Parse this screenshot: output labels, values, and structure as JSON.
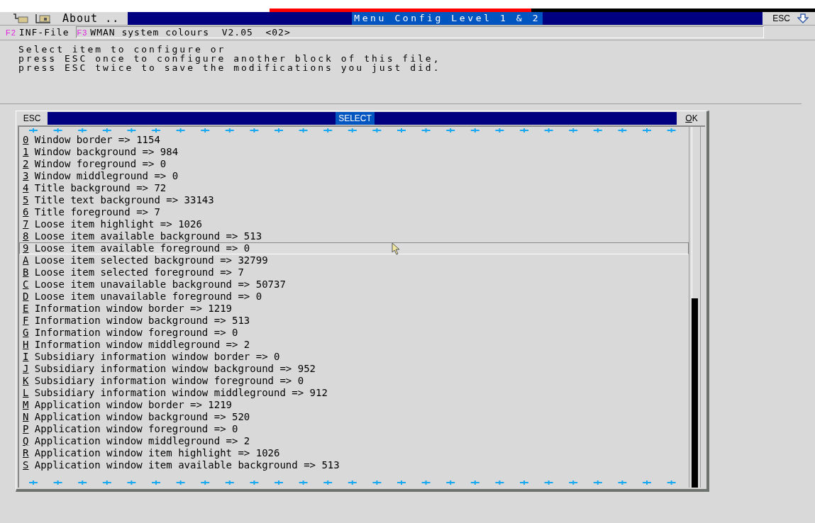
{
  "progress": {
    "level": 0.48
  },
  "menu_bar": {
    "about": "About ..",
    "title": "Menu Config Level 1 & 2",
    "esc": "ESC"
  },
  "function_bar": [
    {
      "key": "F2",
      "label": "INF-File"
    },
    {
      "key": "F3",
      "label": "WMAN system colours  V2.05  <02>"
    }
  ],
  "instructions": [
    "Select item to configure or",
    "press ESC once to configure another block of this file,",
    "press ESC twice to save the modifications you just did."
  ],
  "dialog": {
    "esc": "ESC",
    "title": "SELECT",
    "ok_key": "O",
    "ok_rest": "K",
    "items": [
      {
        "key": "0",
        "label": "Window border => 1154",
        "selected": false
      },
      {
        "key": "1",
        "label": "Window background => 984",
        "selected": false
      },
      {
        "key": "2",
        "label": "Window foreground => 0",
        "selected": false
      },
      {
        "key": "3",
        "label": "Window middleground => 0",
        "selected": false
      },
      {
        "key": "4",
        "label": "Title background => 72",
        "selected": false
      },
      {
        "key": "5",
        "label": "Title text background => 33143",
        "selected": false
      },
      {
        "key": "6",
        "label": "Title foreground => 7",
        "selected": false
      },
      {
        "key": "7",
        "label": "Loose item highlight => 1026",
        "selected": false
      },
      {
        "key": "8",
        "label": "Loose item available background => 513",
        "selected": false
      },
      {
        "key": "9",
        "label": "Loose item available foreground => 0",
        "selected": true
      },
      {
        "key": "A",
        "label": "Loose item selected background => 32799",
        "selected": false
      },
      {
        "key": "B",
        "label": "Loose item selected foreground => 7",
        "selected": false
      },
      {
        "key": "C",
        "label": "Loose item unavailable background => 50737",
        "selected": false
      },
      {
        "key": "D",
        "label": "Loose item unavailable foreground => 0",
        "selected": false
      },
      {
        "key": "E",
        "label": "Information window border => 1219",
        "selected": false
      },
      {
        "key": "F",
        "label": "Information window background => 513",
        "selected": false
      },
      {
        "key": "G",
        "label": "Information window foreground => 0",
        "selected": false
      },
      {
        "key": "H",
        "label": "Information window middleground => 2",
        "selected": false
      },
      {
        "key": "I",
        "label": "Subsidiary information window border => 0",
        "selected": false
      },
      {
        "key": "J",
        "label": "Subsidiary information window background => 952",
        "selected": false
      },
      {
        "key": "K",
        "label": "Subsidiary information window foreground => 0",
        "selected": false
      },
      {
        "key": "L",
        "label": "Subsidiary information window middleground => 912",
        "selected": false
      },
      {
        "key": "M",
        "label": "Application window border => 1219",
        "selected": false
      },
      {
        "key": "N",
        "label": "Application window background => 520",
        "selected": false
      },
      {
        "key": "P",
        "label": "Application window foreground => 0",
        "selected": false
      },
      {
        "key": "Q",
        "label": "Application window middleground => 2",
        "selected": false
      },
      {
        "key": "R",
        "label": "Application window item highlight => 1026",
        "selected": false
      },
      {
        "key": "S",
        "label": "Application window item available background => 513",
        "selected": false
      }
    ]
  }
}
